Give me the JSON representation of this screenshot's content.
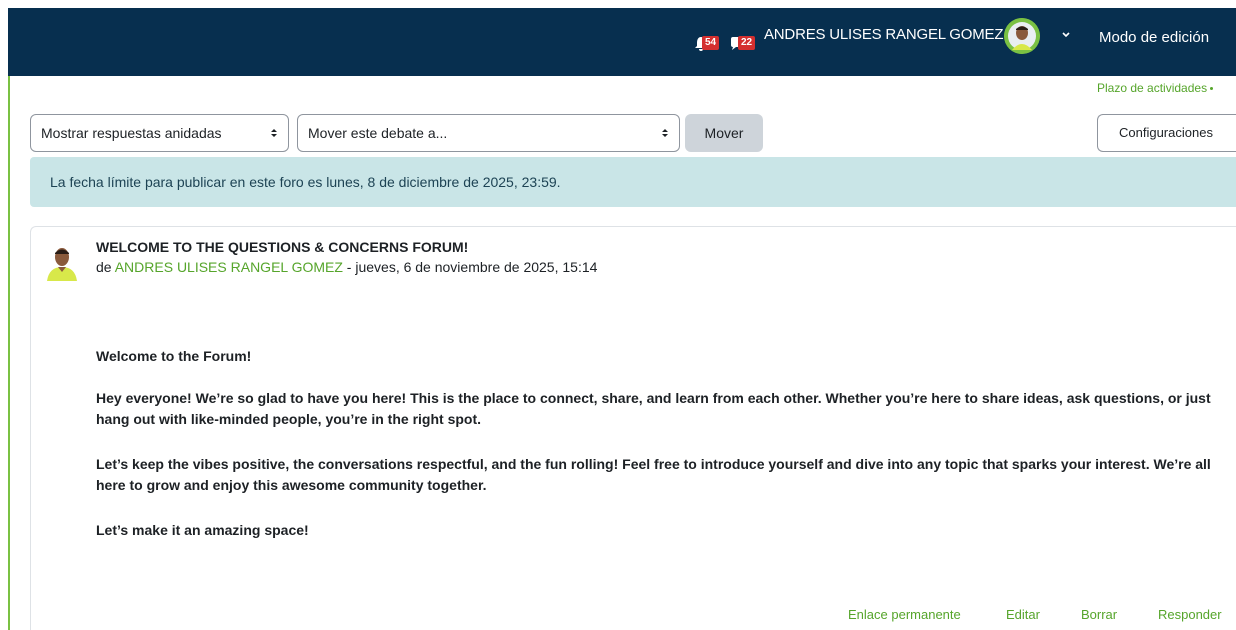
{
  "navbar": {
    "notifications_count": "54",
    "messages_count": "22",
    "user_name": "ANDRES ULISES RANGEL GOMEZ",
    "edit_mode_label": "Modo de edición",
    "bg_color": "#072f4f"
  },
  "deadline_link": "Plazo de actividades",
  "controls": {
    "display_mode": "Mostrar respuestas anidadas",
    "move_select": "Mover este debate a...",
    "move_button": "Mover",
    "settings_button": "Configuraciones"
  },
  "alert": {
    "text": "La fecha límite para publicar en este foro es lunes, 8 de diciembre de 2025, 23:59."
  },
  "post": {
    "title": "WELCOME TO THE QUESTIONS & CONCERNS FORUM!",
    "by_prefix": "de ",
    "author": "ANDRES ULISES RANGEL GOMEZ",
    "date": " - jueves, 6 de noviembre de 2025, 15:14",
    "paragraphs": [
      "Welcome to the Forum!",
      "Hey everyone! We’re so glad to have you here! This is the place to connect, share, and learn from each other. Whether you’re here to share ideas, ask questions, or just hang out with like-minded people, you’re in the right spot.",
      "Let’s keep the vibes positive, the conversations respectful, and the fun rolling!  Feel free to introduce yourself and dive into any topic that sparks your interest. We’re all here to grow and enjoy this awesome community together.",
      "Let’s make it an amazing space!"
    ],
    "actions": {
      "permalink": "Enlace permanente",
      "edit": "Editar",
      "delete": "Borrar",
      "reply": "Responder"
    }
  },
  "colors": {
    "accent_green": "#56a52b",
    "alert_bg": "#c9e5e7",
    "badge_red": "#d42f2f"
  }
}
